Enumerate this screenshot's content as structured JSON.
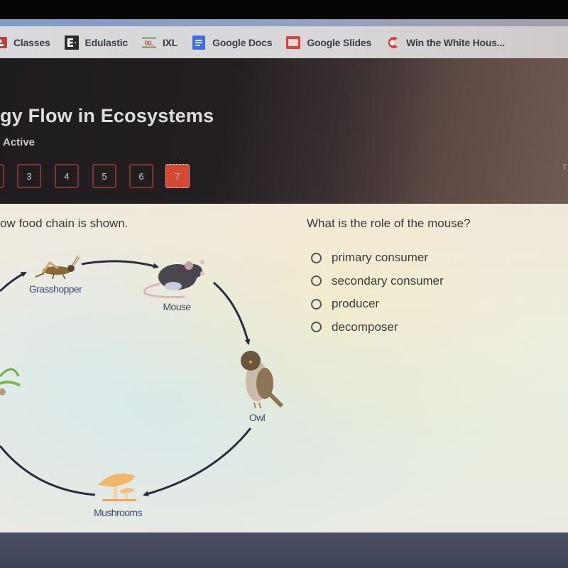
{
  "bookmarks": [
    {
      "label": "Classes",
      "icon": "classes-icon",
      "color": "#c0392b"
    },
    {
      "label": "Edulastic",
      "icon": "edulastic-icon",
      "color": "#2b2b2b"
    },
    {
      "label": "IXL",
      "icon": "ixl-icon",
      "color": "#c0392b"
    },
    {
      "label": "Google Docs",
      "icon": "google-docs-icon",
      "color": "#3b6fe0"
    },
    {
      "label": "Google Slides",
      "icon": "google-slides-icon",
      "color": "#d9443a"
    },
    {
      "label": "Win the White Hous...",
      "icon": "win-the-white-house-icon",
      "color": "#d9443a"
    }
  ],
  "header": {
    "title": "gy Flow in Ecosystems",
    "status": "Active",
    "right_text": "T",
    "accent": "#d24a33",
    "question_numbers": [
      {
        "label": "",
        "active": false
      },
      {
        "label": "3",
        "active": false
      },
      {
        "label": "4",
        "active": false
      },
      {
        "label": "5",
        "active": false
      },
      {
        "label": "6",
        "active": false
      },
      {
        "label": "7",
        "active": true
      }
    ]
  },
  "prompt": "ow food chain is shown.",
  "diagram": {
    "organisms": [
      {
        "name": "Grasshopper"
      },
      {
        "name": "Mouse"
      },
      {
        "name": "Owl"
      },
      {
        "name": "Mushrooms"
      },
      {
        "name": ""
      }
    ]
  },
  "question": {
    "text": "What is the role of the mouse?",
    "options": [
      {
        "label": "primary consumer",
        "selected": false
      },
      {
        "label": "secondary consumer",
        "selected": false
      },
      {
        "label": "producer",
        "selected": false
      },
      {
        "label": "decomposer",
        "selected": false
      }
    ]
  }
}
